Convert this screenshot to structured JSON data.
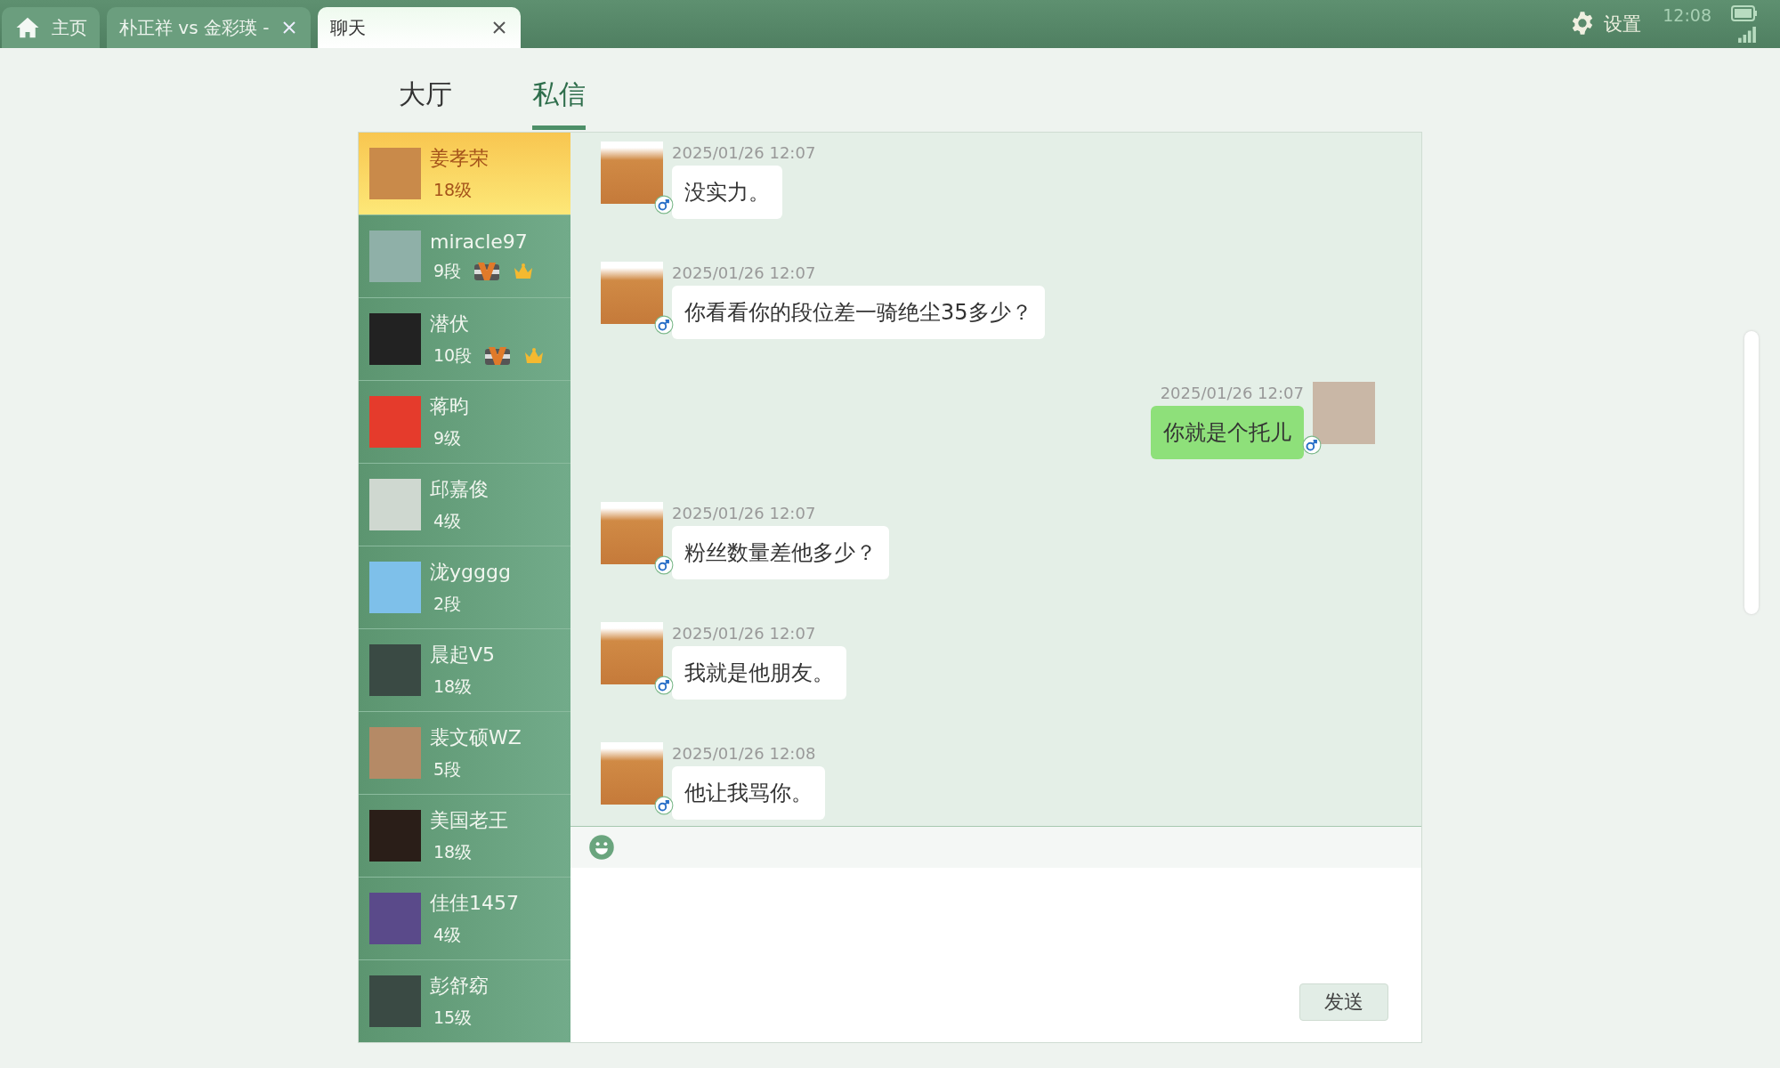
{
  "top_tabs": [
    {
      "kind": "home",
      "label": "主页",
      "selected": false,
      "closable": false
    },
    {
      "kind": "page",
      "label": "朴正祥 vs 金彩瑛 -",
      "selected": false,
      "closable": true
    },
    {
      "kind": "page",
      "label": "聊天",
      "selected": true,
      "closable": true
    }
  ],
  "status_bar": {
    "settings_label": "设置",
    "time": "12:08"
  },
  "section_tabs": [
    {
      "label": "大厅",
      "selected": false
    },
    {
      "label": "私信",
      "selected": true
    }
  ],
  "contacts": [
    {
      "name": "姜孝荣",
      "rank": "18级",
      "selected": true,
      "vip": false,
      "crown": false
    },
    {
      "name": "miracle97",
      "rank": "9段",
      "selected": false,
      "vip": true,
      "crown": true
    },
    {
      "name": "潜伏",
      "rank": "10段",
      "selected": false,
      "vip": true,
      "crown": true
    },
    {
      "name": "蒋昀",
      "rank": "9级",
      "selected": false,
      "vip": false,
      "crown": false
    },
    {
      "name": "邱嘉俊",
      "rank": "4级",
      "selected": false,
      "vip": false,
      "crown": false
    },
    {
      "name": "泷ygggg",
      "rank": "2段",
      "selected": false,
      "vip": false,
      "crown": false
    },
    {
      "name": "晨起V5",
      "rank": "18级",
      "selected": false,
      "vip": false,
      "crown": false
    },
    {
      "name": "裴文硕WZ",
      "rank": "5段",
      "selected": false,
      "vip": false,
      "crown": false
    },
    {
      "name": "美国老王",
      "rank": "18级",
      "selected": false,
      "vip": false,
      "crown": false
    },
    {
      "name": "佳佳1457",
      "rank": "4级",
      "selected": false,
      "vip": false,
      "crown": false
    },
    {
      "name": "彭舒窈",
      "rank": "15级",
      "selected": false,
      "vip": false,
      "crown": false
    }
  ],
  "messages": [
    {
      "kind": "received",
      "time": "2025/01/26 12:07",
      "text": "没实力。"
    },
    {
      "kind": "received",
      "time": "2025/01/26 12:07",
      "text": "你看看你的段位差一骑绝尘35多少？"
    },
    {
      "kind": "sent",
      "time": "2025/01/26 12:07",
      "text": "你就是个托儿"
    },
    {
      "kind": "received",
      "time": "2025/01/26 12:07",
      "text": "粉丝数量差他多少？"
    },
    {
      "kind": "received",
      "time": "2025/01/26 12:07",
      "text": "我就是他朋友。"
    },
    {
      "kind": "received",
      "time": "2025/01/26 12:08",
      "text": "他让我骂你。"
    }
  ],
  "send_button": "发送"
}
